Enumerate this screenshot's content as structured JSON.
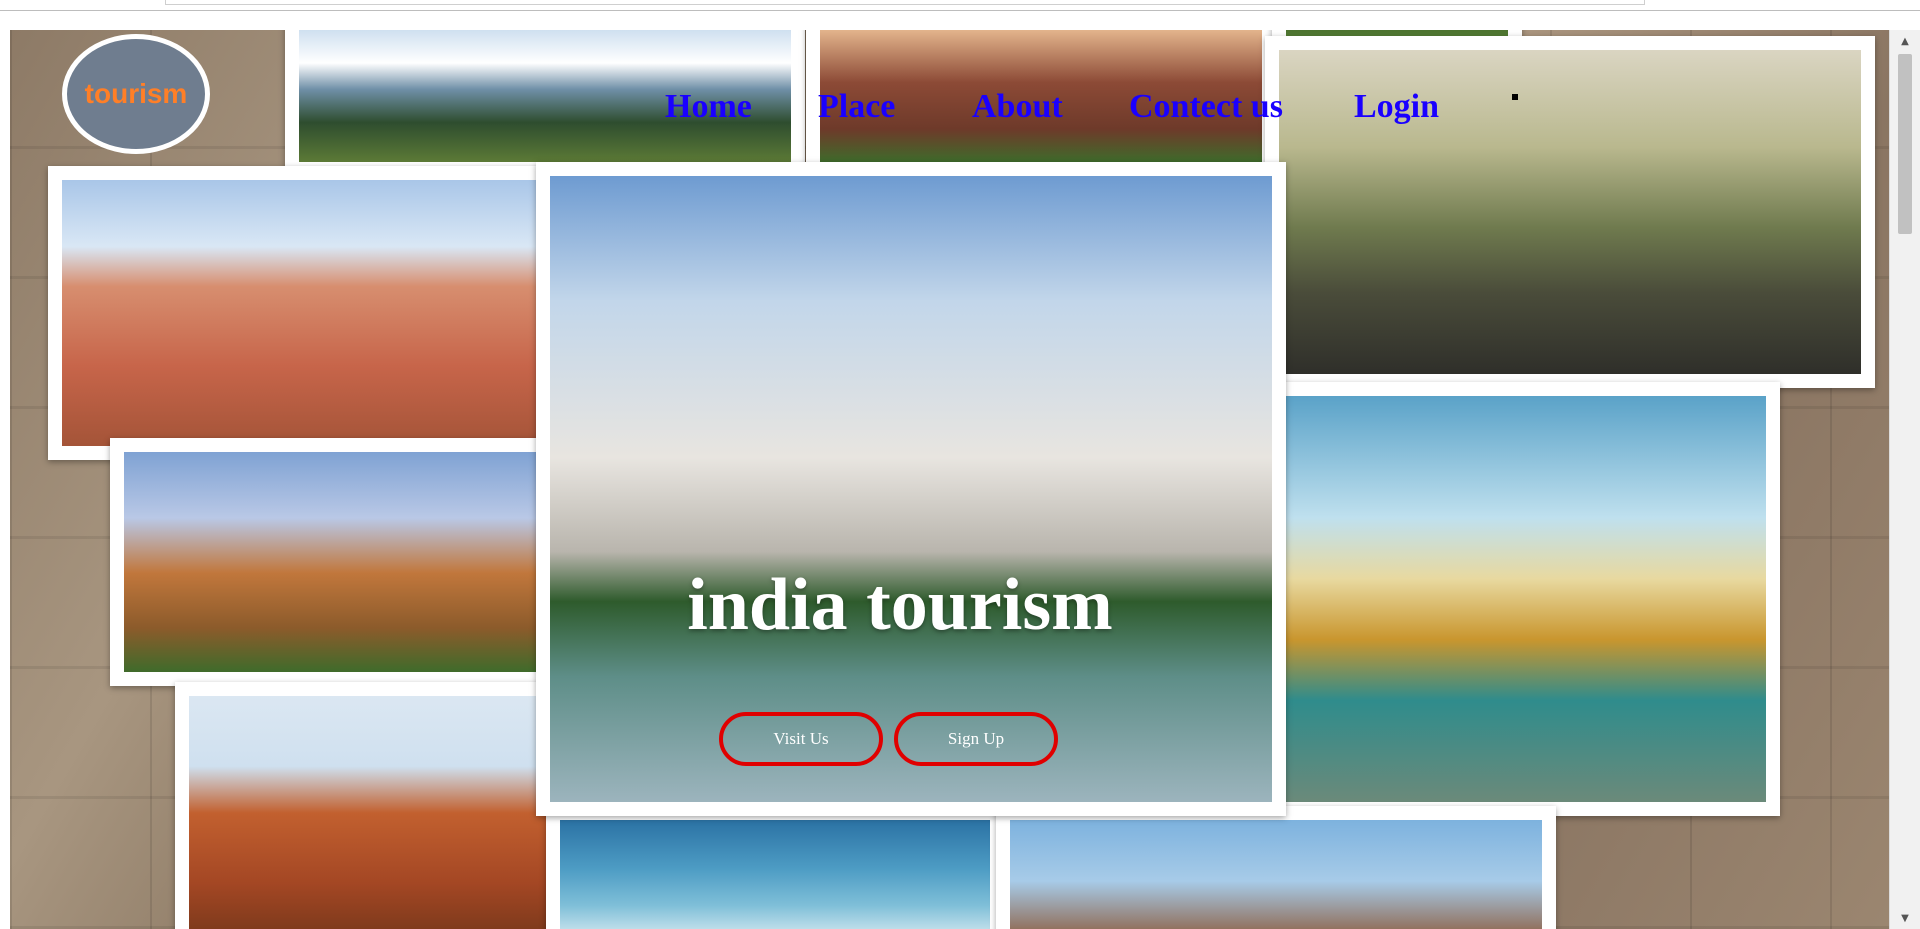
{
  "logo": {
    "text": "tourism"
  },
  "nav": {
    "items": [
      {
        "label": "Home"
      },
      {
        "label": "Place"
      },
      {
        "label": "About"
      },
      {
        "label": "Contect us"
      },
      {
        "label": "Login"
      }
    ]
  },
  "hero": {
    "title": "india tourism",
    "buttons": {
      "visit": "Visit Us",
      "signup": "Sign Up"
    }
  },
  "colors": {
    "nav_link": "#1a00ff",
    "logo_text": "#ff7f27",
    "logo_bg": "#6f7d8f",
    "button_border": "#e00000",
    "hero_text": "#ffffff"
  },
  "icons": {
    "scroll_up": "scroll-up-arrow-icon",
    "scroll_down": "scroll-down-arrow-icon"
  }
}
